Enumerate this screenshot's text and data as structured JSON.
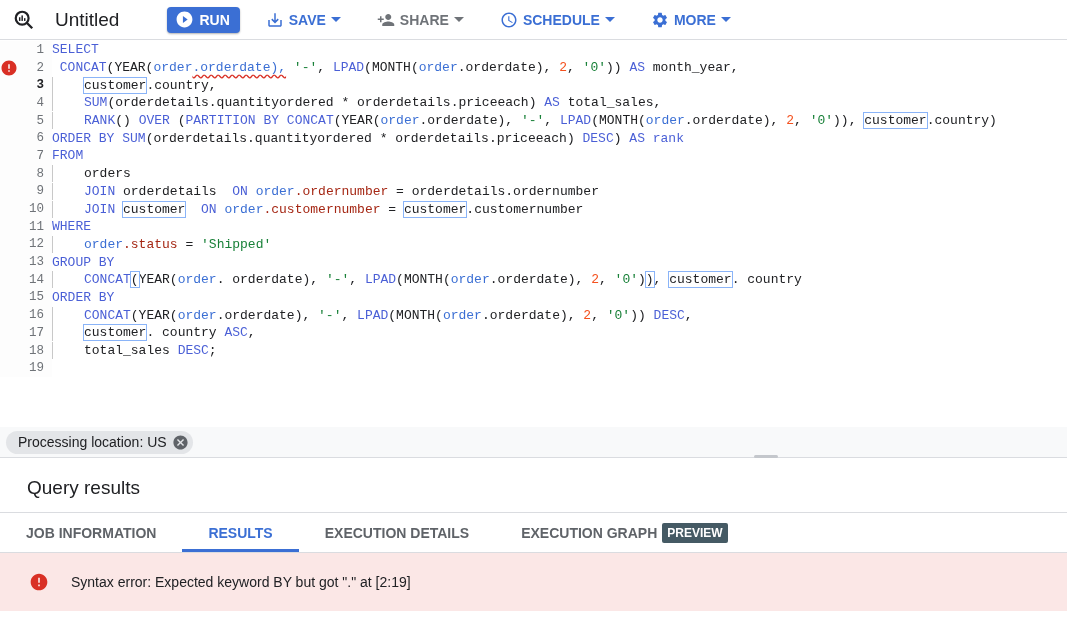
{
  "toolbar": {
    "title": "Untitled",
    "buttons": [
      {
        "label": "RUN",
        "kind": "primary",
        "disabled": false
      },
      {
        "label": "SAVE",
        "kind": "menu",
        "disabled": false
      },
      {
        "label": "SHARE",
        "kind": "menu",
        "disabled": true
      },
      {
        "label": "SCHEDULE",
        "kind": "menu",
        "disabled": false
      },
      {
        "label": "MORE",
        "kind": "menu",
        "disabled": false
      }
    ]
  },
  "editor": {
    "lines": [
      {
        "number": "1",
        "error": false,
        "current": false,
        "indent": false,
        "tokens": [
          {
            "kind": "kw",
            "text": "SELECT"
          }
        ]
      },
      {
        "number": "2",
        "error": true,
        "current": false,
        "indent": false,
        "tokens": [
          {
            "kind": "kw",
            "text": " CONCAT"
          },
          {
            "kind": "text",
            "text": "(YEAR("
          },
          {
            "kind": "obj",
            "text": "order"
          },
          {
            "kind": "err",
            "text": ".orderdate),"
          },
          {
            "kind": "str",
            "text": " '-'"
          },
          {
            "kind": "text",
            "text": ", "
          },
          {
            "kind": "kw",
            "text": "LPAD"
          },
          {
            "kind": "text",
            "text": "(MONTH("
          },
          {
            "kind": "obj",
            "text": "order"
          },
          {
            "kind": "text",
            "text": ".orderdate), "
          },
          {
            "kind": "num",
            "text": "2"
          },
          {
            "kind": "text",
            "text": ", "
          },
          {
            "kind": "str",
            "text": "'0'"
          },
          {
            "kind": "text",
            "text": ")) "
          },
          {
            "kind": "kw",
            "text": "AS"
          },
          {
            "kind": "text",
            "text": " month_year,"
          }
        ]
      },
      {
        "number": "3",
        "error": false,
        "current": true,
        "indent": true,
        "tokens": [
          {
            "kind": "box",
            "text": "customer"
          },
          {
            "kind": "text",
            "text": ".country,"
          }
        ]
      },
      {
        "number": "4",
        "error": false,
        "current": false,
        "indent": true,
        "tokens": [
          {
            "kind": "kw",
            "text": "SUM"
          },
          {
            "kind": "text",
            "text": "(orderdetails.quantityordered * orderdetails.priceeach) "
          },
          {
            "kind": "kw",
            "text": "AS"
          },
          {
            "kind": "text",
            "text": " total_sales,"
          }
        ]
      },
      {
        "number": "5",
        "error": false,
        "current": false,
        "indent": true,
        "tokens": [
          {
            "kind": "kw",
            "text": "RANK"
          },
          {
            "kind": "text",
            "text": "() "
          },
          {
            "kind": "kw",
            "text": "OVER"
          },
          {
            "kind": "text",
            "text": " ("
          },
          {
            "kind": "kw",
            "text": "PARTITION BY CONCAT"
          },
          {
            "kind": "text",
            "text": "(YEAR("
          },
          {
            "kind": "obj",
            "text": "order"
          },
          {
            "kind": "text",
            "text": ".orderdate), "
          },
          {
            "kind": "str",
            "text": "'-'"
          },
          {
            "kind": "text",
            "text": ", "
          },
          {
            "kind": "kw",
            "text": "LPAD"
          },
          {
            "kind": "text",
            "text": "(MONTH("
          },
          {
            "kind": "obj",
            "text": "order"
          },
          {
            "kind": "text",
            "text": ".orderdate), "
          },
          {
            "kind": "num",
            "text": "2"
          },
          {
            "kind": "text",
            "text": ", "
          },
          {
            "kind": "str",
            "text": "'0'"
          },
          {
            "kind": "text",
            "text": ")), "
          },
          {
            "kind": "box",
            "text": "customer"
          },
          {
            "kind": "text",
            "text": ".country)"
          }
        ]
      },
      {
        "number": "6",
        "error": false,
        "current": false,
        "indent": false,
        "tokens": [
          {
            "kind": "kw",
            "text": "ORDER BY SUM"
          },
          {
            "kind": "text",
            "text": "(orderdetails.quantityordered * orderdetails.priceeach) "
          },
          {
            "kind": "kw",
            "text": "DESC"
          },
          {
            "kind": "text",
            "text": ") "
          },
          {
            "kind": "kw",
            "text": "AS rank"
          }
        ]
      },
      {
        "number": "7",
        "error": false,
        "current": false,
        "indent": false,
        "tokens": [
          {
            "kind": "kw",
            "text": "FROM"
          }
        ]
      },
      {
        "number": "8",
        "error": false,
        "current": false,
        "indent": true,
        "tokens": [
          {
            "kind": "text",
            "text": "orders"
          }
        ]
      },
      {
        "number": "9",
        "error": false,
        "current": false,
        "indent": true,
        "tokens": [
          {
            "kind": "kw",
            "text": "JOIN"
          },
          {
            "kind": "text",
            "text": " orderdetails  "
          },
          {
            "kind": "kw",
            "text": "ON "
          },
          {
            "kind": "obj",
            "text": "order"
          },
          {
            "kind": "field",
            "text": ".ordernumber"
          },
          {
            "kind": "text",
            "text": " = orderdetails.ordernumber"
          }
        ]
      },
      {
        "number": "10",
        "error": false,
        "current": false,
        "indent": true,
        "tokens": [
          {
            "kind": "kw",
            "text": "JOIN "
          },
          {
            "kind": "box",
            "text": "customer"
          },
          {
            "kind": "kw",
            "text": "  ON "
          },
          {
            "kind": "obj",
            "text": "order"
          },
          {
            "kind": "field",
            "text": ".customernumber"
          },
          {
            "kind": "text",
            "text": " = "
          },
          {
            "kind": "box",
            "text": "customer"
          },
          {
            "kind": "text",
            "text": ".customernumber"
          }
        ]
      },
      {
        "number": "11",
        "error": false,
        "current": false,
        "indent": false,
        "tokens": [
          {
            "kind": "kw",
            "text": "WHERE"
          }
        ]
      },
      {
        "number": "12",
        "error": false,
        "current": false,
        "indent": true,
        "tokens": [
          {
            "kind": "obj",
            "text": "order"
          },
          {
            "kind": "field",
            "text": ".status"
          },
          {
            "kind": "text",
            "text": " = "
          },
          {
            "kind": "str",
            "text": "'Shipped'"
          }
        ]
      },
      {
        "number": "13",
        "error": false,
        "current": false,
        "indent": false,
        "tokens": [
          {
            "kind": "kw",
            "text": "GROUP BY"
          }
        ]
      },
      {
        "number": "14",
        "error": false,
        "current": false,
        "indent": true,
        "tokens": [
          {
            "kind": "kw",
            "text": "CONCAT"
          },
          {
            "kind": "box",
            "text": "("
          },
          {
            "kind": "text",
            "text": "YEAR("
          },
          {
            "kind": "obj",
            "text": "order"
          },
          {
            "kind": "text",
            "text": ". orderdate), "
          },
          {
            "kind": "str",
            "text": "'-'"
          },
          {
            "kind": "text",
            "text": ", "
          },
          {
            "kind": "kw",
            "text": "LPAD"
          },
          {
            "kind": "text",
            "text": "(MONTH("
          },
          {
            "kind": "obj",
            "text": "order"
          },
          {
            "kind": "text",
            "text": ".orderdate), "
          },
          {
            "kind": "num",
            "text": "2"
          },
          {
            "kind": "text",
            "text": ", "
          },
          {
            "kind": "str",
            "text": "'0'"
          },
          {
            "kind": "text",
            "text": ")"
          },
          {
            "kind": "box",
            "text": ")"
          },
          {
            "kind": "text",
            "text": ", "
          },
          {
            "kind": "box",
            "text": "customer"
          },
          {
            "kind": "text",
            "text": ". country"
          }
        ]
      },
      {
        "number": "15",
        "error": false,
        "current": false,
        "indent": false,
        "tokens": [
          {
            "kind": "kw",
            "text": "ORDER BY"
          }
        ]
      },
      {
        "number": "16",
        "error": false,
        "current": false,
        "indent": true,
        "tokens": [
          {
            "kind": "kw",
            "text": "CONCAT"
          },
          {
            "kind": "text",
            "text": "(YEAR("
          },
          {
            "kind": "obj",
            "text": "order"
          },
          {
            "kind": "text",
            "text": ".orderdate), "
          },
          {
            "kind": "str",
            "text": "'-'"
          },
          {
            "kind": "text",
            "text": ", "
          },
          {
            "kind": "kw",
            "text": "LPAD"
          },
          {
            "kind": "text",
            "text": "(MONTH("
          },
          {
            "kind": "obj",
            "text": "order"
          },
          {
            "kind": "text",
            "text": ".orderdate), "
          },
          {
            "kind": "num",
            "text": "2"
          },
          {
            "kind": "text",
            "text": ", "
          },
          {
            "kind": "str",
            "text": "'0'"
          },
          {
            "kind": "text",
            "text": ")) "
          },
          {
            "kind": "kw",
            "text": "DESC"
          },
          {
            "kind": "text",
            "text": ","
          }
        ]
      },
      {
        "number": "17",
        "error": false,
        "current": false,
        "indent": true,
        "tokens": [
          {
            "kind": "box",
            "text": "customer"
          },
          {
            "kind": "text",
            "text": ". country "
          },
          {
            "kind": "kw",
            "text": "ASC"
          },
          {
            "kind": "text",
            "text": ","
          }
        ]
      },
      {
        "number": "18",
        "error": false,
        "current": false,
        "indent": true,
        "tokens": [
          {
            "kind": "text",
            "text": "total_sales "
          },
          {
            "kind": "kw",
            "text": "DESC"
          },
          {
            "kind": "text",
            "text": ";"
          }
        ]
      },
      {
        "number": "19",
        "error": false,
        "current": false
      }
    ]
  },
  "location_chip": {
    "label": "Processing location: US"
  },
  "results": {
    "title": "Query results",
    "tabs": [
      {
        "label": "JOB INFORMATION",
        "selected": false
      },
      {
        "label": "RESULTS",
        "selected": true
      },
      {
        "label": "EXECUTION DETAILS",
        "selected": false
      },
      {
        "label": "EXECUTION GRAPH",
        "selected": false,
        "badge": "PREVIEW"
      }
    ],
    "error_message": "Syntax error: Expected keyword BY but got \".\" at [2:19]"
  }
}
